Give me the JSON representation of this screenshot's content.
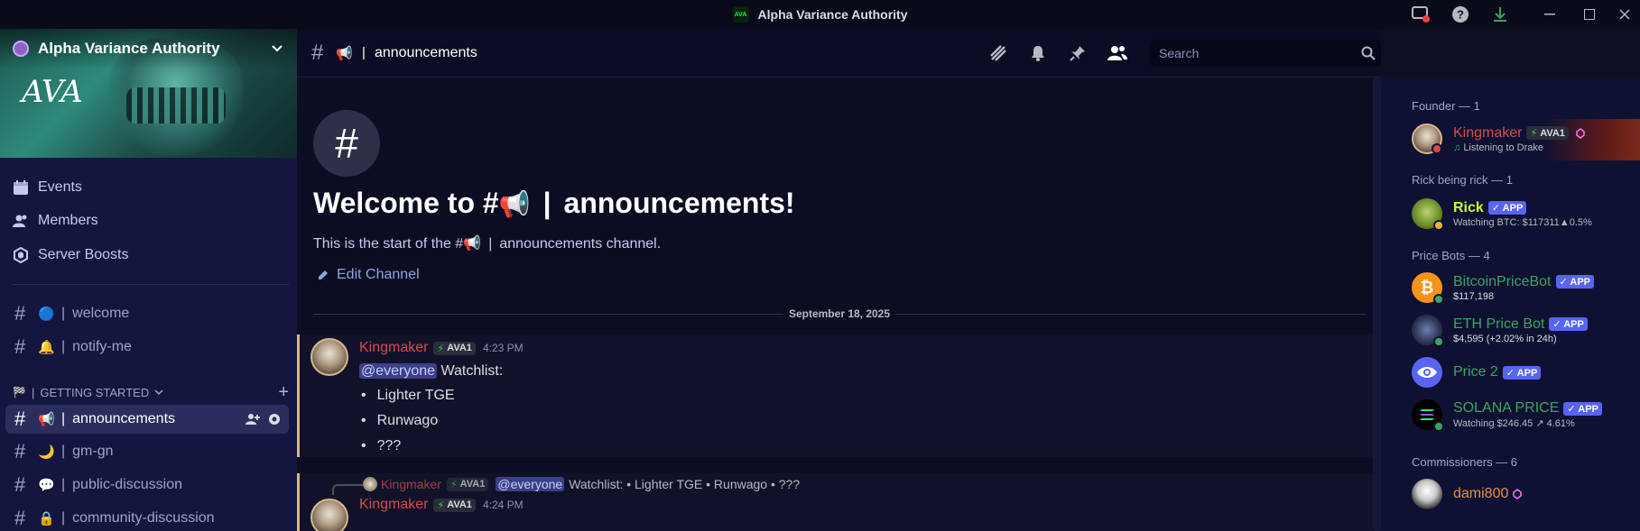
{
  "titlebar": {
    "title": "Alpha Variance Authority",
    "logo_text": "AVA",
    "icons": [
      "screen-share-icon",
      "help-icon",
      "download-icon"
    ],
    "window_controls": [
      "minimize-icon",
      "maximize-icon",
      "close-icon"
    ]
  },
  "server": {
    "name": "Alpha Variance Authority",
    "banner_logo": "AVA"
  },
  "nav": [
    {
      "label": "Events",
      "icon": "calendar-icon"
    },
    {
      "label": "Members",
      "icon": "members-icon"
    },
    {
      "label": "Server Boosts",
      "icon": "boost-icon"
    }
  ],
  "channels_top": [
    {
      "emoji": "🔵",
      "name": "welcome"
    },
    {
      "emoji": "🔔",
      "name": "notify-me"
    }
  ],
  "category": {
    "emoji": "🏁",
    "name": "GETTING STARTED"
  },
  "channels_cat": [
    {
      "emoji": "📢",
      "name": "announcements",
      "active": true
    },
    {
      "emoji": "🌙",
      "name": "gm-gn"
    },
    {
      "emoji": "💬",
      "name": "public-discussion"
    },
    {
      "emoji": "🔒",
      "name": "community-discussion"
    }
  ],
  "header": {
    "channel_emoji": "📢",
    "channel_name": "announcements",
    "search_placeholder": "Search"
  },
  "welcome": {
    "title_prefix": "Welcome to #",
    "title_emoji": "📢",
    "title_name": "announcements!",
    "sub_prefix": "This is the start of the #",
    "sub_emoji": "📢",
    "sub_suffix": "announcements channel.",
    "edit_label": "Edit Channel"
  },
  "date_divider": "September 18, 2025",
  "messages": [
    {
      "author": "Kingmaker",
      "role": "AVA1",
      "time": "4:23 PM",
      "mention": "@everyone",
      "text": "Watchlist:",
      "bullets": [
        "Lighter TGE",
        "Runwago",
        "???"
      ]
    },
    {
      "author": "Kingmaker",
      "role": "AVA1",
      "time": "4:24 PM",
      "reply": {
        "author": "Kingmaker",
        "role": "AVA1",
        "mention": "@everyone",
        "text": "Watchlist: • Lighter TGE  • Runwago  • ???"
      }
    }
  ],
  "members": {
    "groups": [
      {
        "header": "Founder — 1"
      },
      {
        "header": "Rick being rick — 1"
      },
      {
        "header": "Price Bots — 4"
      },
      {
        "header": "Commissioners — 6"
      }
    ],
    "list": [
      {
        "name": "Kingmaker",
        "role": "AVA1",
        "sub": "Listening to Drake",
        "color": "#d64a4a"
      },
      {
        "name": "Rick",
        "tag": "APP",
        "sub": "Watching BTC: $117311▲0.5%",
        "color": "#c4ff3a"
      },
      {
        "name": "BitcoinPriceBot",
        "tag": "APP",
        "sub": "$117,198",
        "color": "#3ba55d"
      },
      {
        "name": "ETH Price Bot",
        "tag": "APP",
        "sub": "$4,595 (+2.02% in 24h)",
        "color": "#3ba55d"
      },
      {
        "name": "Price 2",
        "tag": "APP",
        "sub": "",
        "color": "#3ba55d"
      },
      {
        "name": "SOLANA PRICE",
        "tag": "APP",
        "sub": "Watching $246.45 ↗ 4.61%",
        "color": "#3ba55d"
      },
      {
        "name": "dami800",
        "color": "#e0914a"
      }
    ]
  },
  "colors": {
    "sidebar_bg": "#141640",
    "main_bg": "#0c0d22",
    "accent": "#5865f2",
    "founder_red": "#d64a4a",
    "bot_green": "#3ba55d"
  }
}
